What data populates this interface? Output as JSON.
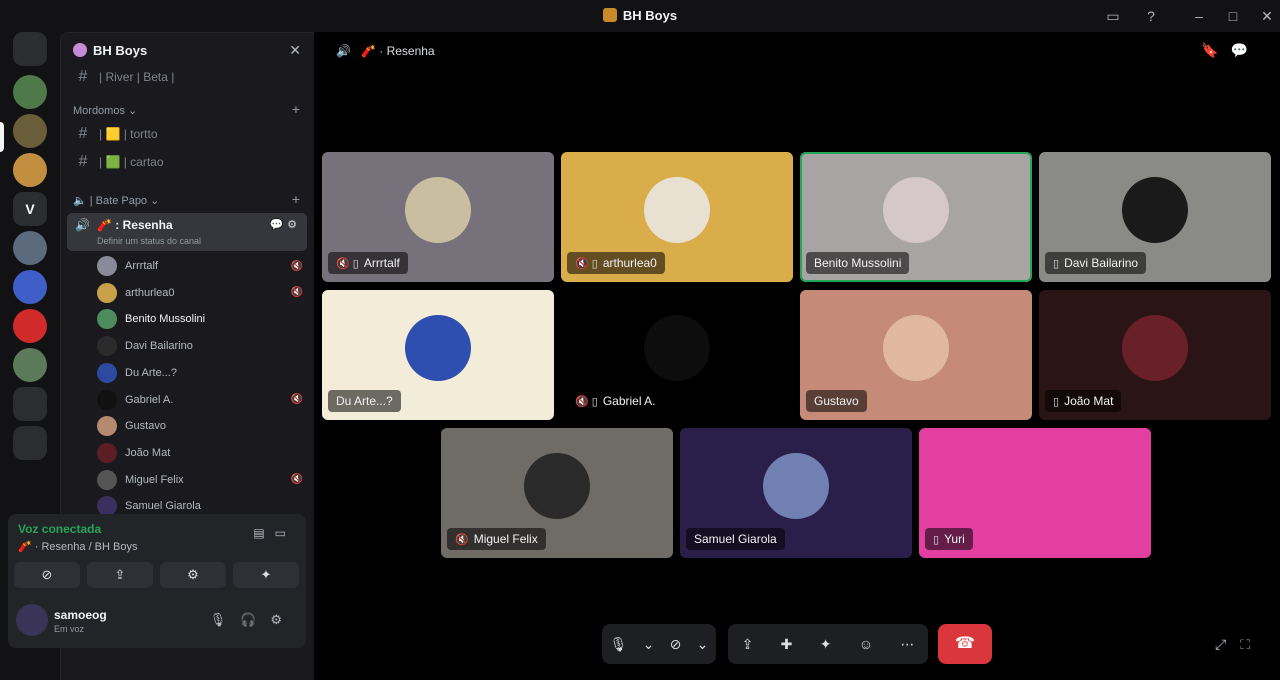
{
  "window": {
    "title": "BH Boys",
    "controls": [
      "inbox-icon",
      "help-icon",
      "minimize-icon",
      "maximize-icon",
      "close-icon"
    ]
  },
  "guilds": [
    {
      "name": "discord-home",
      "label": "",
      "color": "#2b2d31"
    },
    {
      "name": "guild-1",
      "label": "",
      "color": "#4e7a4a"
    },
    {
      "name": "guild-2",
      "label": "",
      "color": "#6a5d3a"
    },
    {
      "name": "guild-3",
      "label": "",
      "color": "#c28e3f"
    },
    {
      "name": "guild-v",
      "label": "V",
      "color": "#2b2d31"
    },
    {
      "name": "guild-5",
      "label": "",
      "color": "#5b6a7c"
    },
    {
      "name": "guild-6",
      "label": "",
      "color": "#3f5ec8"
    },
    {
      "name": "guild-7",
      "label": "",
      "color": "#d12a2a"
    },
    {
      "name": "guild-8",
      "label": "",
      "color": "#5a7a5a"
    },
    {
      "name": "guild-9",
      "label": "",
      "color": "#2b2d31"
    },
    {
      "name": "guild-10",
      "label": "",
      "color": "#2b2d31"
    }
  ],
  "sidebar": {
    "server_name": "BH Boys",
    "top_channel": "| River | Beta |",
    "category_1": "Mordomos",
    "channels": [
      {
        "name": "tortto",
        "label": "| 🟨 | tortto"
      },
      {
        "name": "cartao",
        "label": "| 🟩 | cartao"
      }
    ],
    "category_2": "| Bate Papo",
    "voice_channel": {
      "label": "Resenha",
      "status_placeholder": "Definir um status do canal"
    },
    "members": [
      {
        "name": "Arrrtalf",
        "color": "#8a8a9a",
        "bright": false,
        "icons": "🔇"
      },
      {
        "name": "arthurlea0",
        "color": "#c9a04a",
        "bright": false,
        "icons": "🔇"
      },
      {
        "name": "Benito Mussolini",
        "color": "#4d8c5c",
        "bright": true,
        "icons": ""
      },
      {
        "name": "Davi Bailarino",
        "color": "#2b2b2b",
        "bright": false,
        "icons": ""
      },
      {
        "name": "Du Arte...?",
        "color": "#2c4aa0",
        "bright": false,
        "icons": ""
      },
      {
        "name": "Gabriel A.",
        "color": "#111111",
        "bright": false,
        "icons": "🔇"
      },
      {
        "name": "Gustavo",
        "color": "#b58a70",
        "bright": false,
        "icons": ""
      },
      {
        "name": "João Mat",
        "color": "#5a1e24",
        "bright": false,
        "icons": ""
      },
      {
        "name": "Miguel Felix",
        "color": "#555555",
        "bright": false,
        "icons": "🔇"
      },
      {
        "name": "Samuel Giarola",
        "color": "#3a3060",
        "bright": false,
        "icons": ""
      },
      {
        "name": "Yuri",
        "color": "#e23fa0",
        "bright": false,
        "icons": ""
      }
    ]
  },
  "voice_panel": {
    "status": "Voz conectada",
    "location": "Resenha / BH Boys",
    "buttons": [
      "camera-icon",
      "screen-share-icon",
      "activities-icon",
      "soundboard-icon"
    ]
  },
  "user": {
    "name": "samoeog",
    "status": "Em voz"
  },
  "stage": {
    "channel_name": "Resenha"
  },
  "tiles": [
    {
      "name": "Arrrtalf",
      "bg": "#76717a",
      "avatar": "#c9bfa0",
      "icons": "🔇 ▯",
      "speaking": false
    },
    {
      "name": "arthurlea0",
      "bg": "#d9ae4a",
      "avatar": "#e8e0d0",
      "icons": "🔇 ▯",
      "speaking": false
    },
    {
      "name": "Benito Mussolini",
      "bg": "#a8a4a4",
      "avatar": "#d4c8c8",
      "icons": "",
      "speaking": true
    },
    {
      "name": "Davi Bailarino",
      "bg": "#8a8a86",
      "avatar": "#1a1a1a",
      "icons": "▯",
      "speaking": false
    },
    {
      "name": "Du Arte...?",
      "bg": "#f2ecd8",
      "avatar": "#2e4fb0",
      "icons": "",
      "speaking": false
    },
    {
      "name": "Gabriel A.",
      "bg": "#000000",
      "avatar": "#0d0d0d",
      "icons": "🔇 ▯",
      "speaking": false
    },
    {
      "name": "Gustavo",
      "bg": "#c68a78",
      "avatar": "#e0b8a0",
      "icons": "",
      "speaking": false
    },
    {
      "name": "João Mat",
      "bg": "#2a1416",
      "avatar": "#6a2028",
      "icons": "▯",
      "speaking": false
    },
    {
      "name": "Miguel Felix",
      "bg": "#6f6b66",
      "avatar": "#2a2a2a",
      "icons": "🔇",
      "speaking": false
    },
    {
      "name": "Samuel Giarola",
      "bg": "#2a1f4a",
      "avatar": "#7080b0",
      "icons": "",
      "speaking": false
    },
    {
      "name": "Yuri",
      "bg": "#e23fa0",
      "avatar": "#e23fa0",
      "icons": "▯",
      "speaking": false
    }
  ]
}
